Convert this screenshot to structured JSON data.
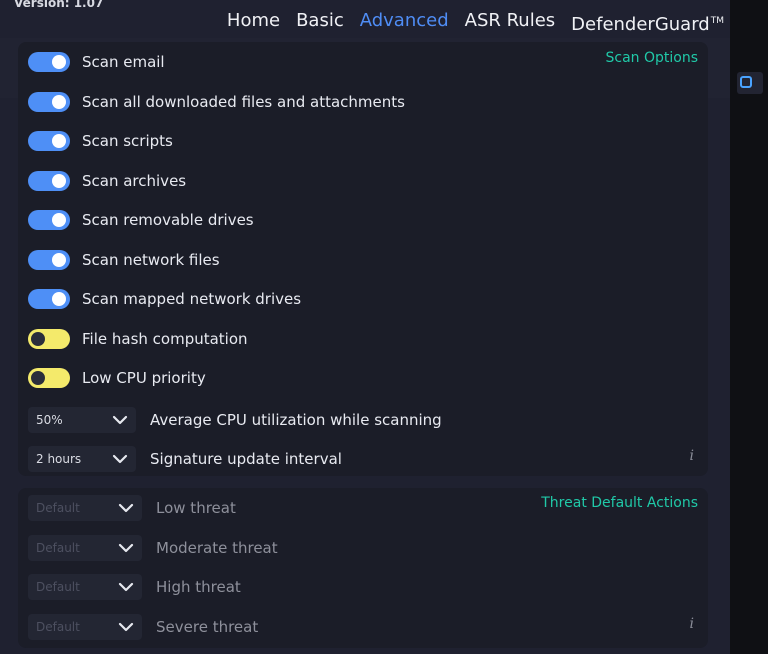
{
  "app": {
    "version": "Version: 1.07"
  },
  "nav": [
    {
      "label": "Home",
      "active": false
    },
    {
      "label": "Basic",
      "active": false
    },
    {
      "label": "Advanced",
      "active": true
    },
    {
      "label": "ASR Rules",
      "active": false
    },
    {
      "label": "DefenderGuard",
      "active": false
    }
  ],
  "nav_trademark": "TM",
  "scan_options": {
    "title": "Scan Options",
    "toggles": [
      {
        "label": "Scan email",
        "on": true
      },
      {
        "label": "Scan all downloaded files and attachments",
        "on": true
      },
      {
        "label": "Scan scripts",
        "on": true
      },
      {
        "label": "Scan archives",
        "on": true
      },
      {
        "label": "Scan removable drives",
        "on": true
      },
      {
        "label": "Scan network files",
        "on": true
      },
      {
        "label": "Scan mapped network drives",
        "on": true
      },
      {
        "label": "File hash computation",
        "on": false
      },
      {
        "label": "Low CPU priority",
        "on": false
      }
    ],
    "selects": [
      {
        "value": "50%",
        "label": "Average CPU utilization while scanning"
      },
      {
        "value": "2 hours",
        "label": "Signature update interval"
      }
    ],
    "info": "i"
  },
  "threat_actions": {
    "title": "Threat Default Actions",
    "rows": [
      {
        "value": "Default",
        "label": "Low threat"
      },
      {
        "value": "Default",
        "label": "Moderate threat"
      },
      {
        "value": "Default",
        "label": "High threat"
      },
      {
        "value": "Default",
        "label": "Severe threat"
      }
    ],
    "info": "i"
  },
  "colors": {
    "accent": "#4f8df5",
    "section_title": "#20c9a8",
    "toggle_on": "#4e8ff6",
    "toggle_off": "#f4ea6b"
  }
}
